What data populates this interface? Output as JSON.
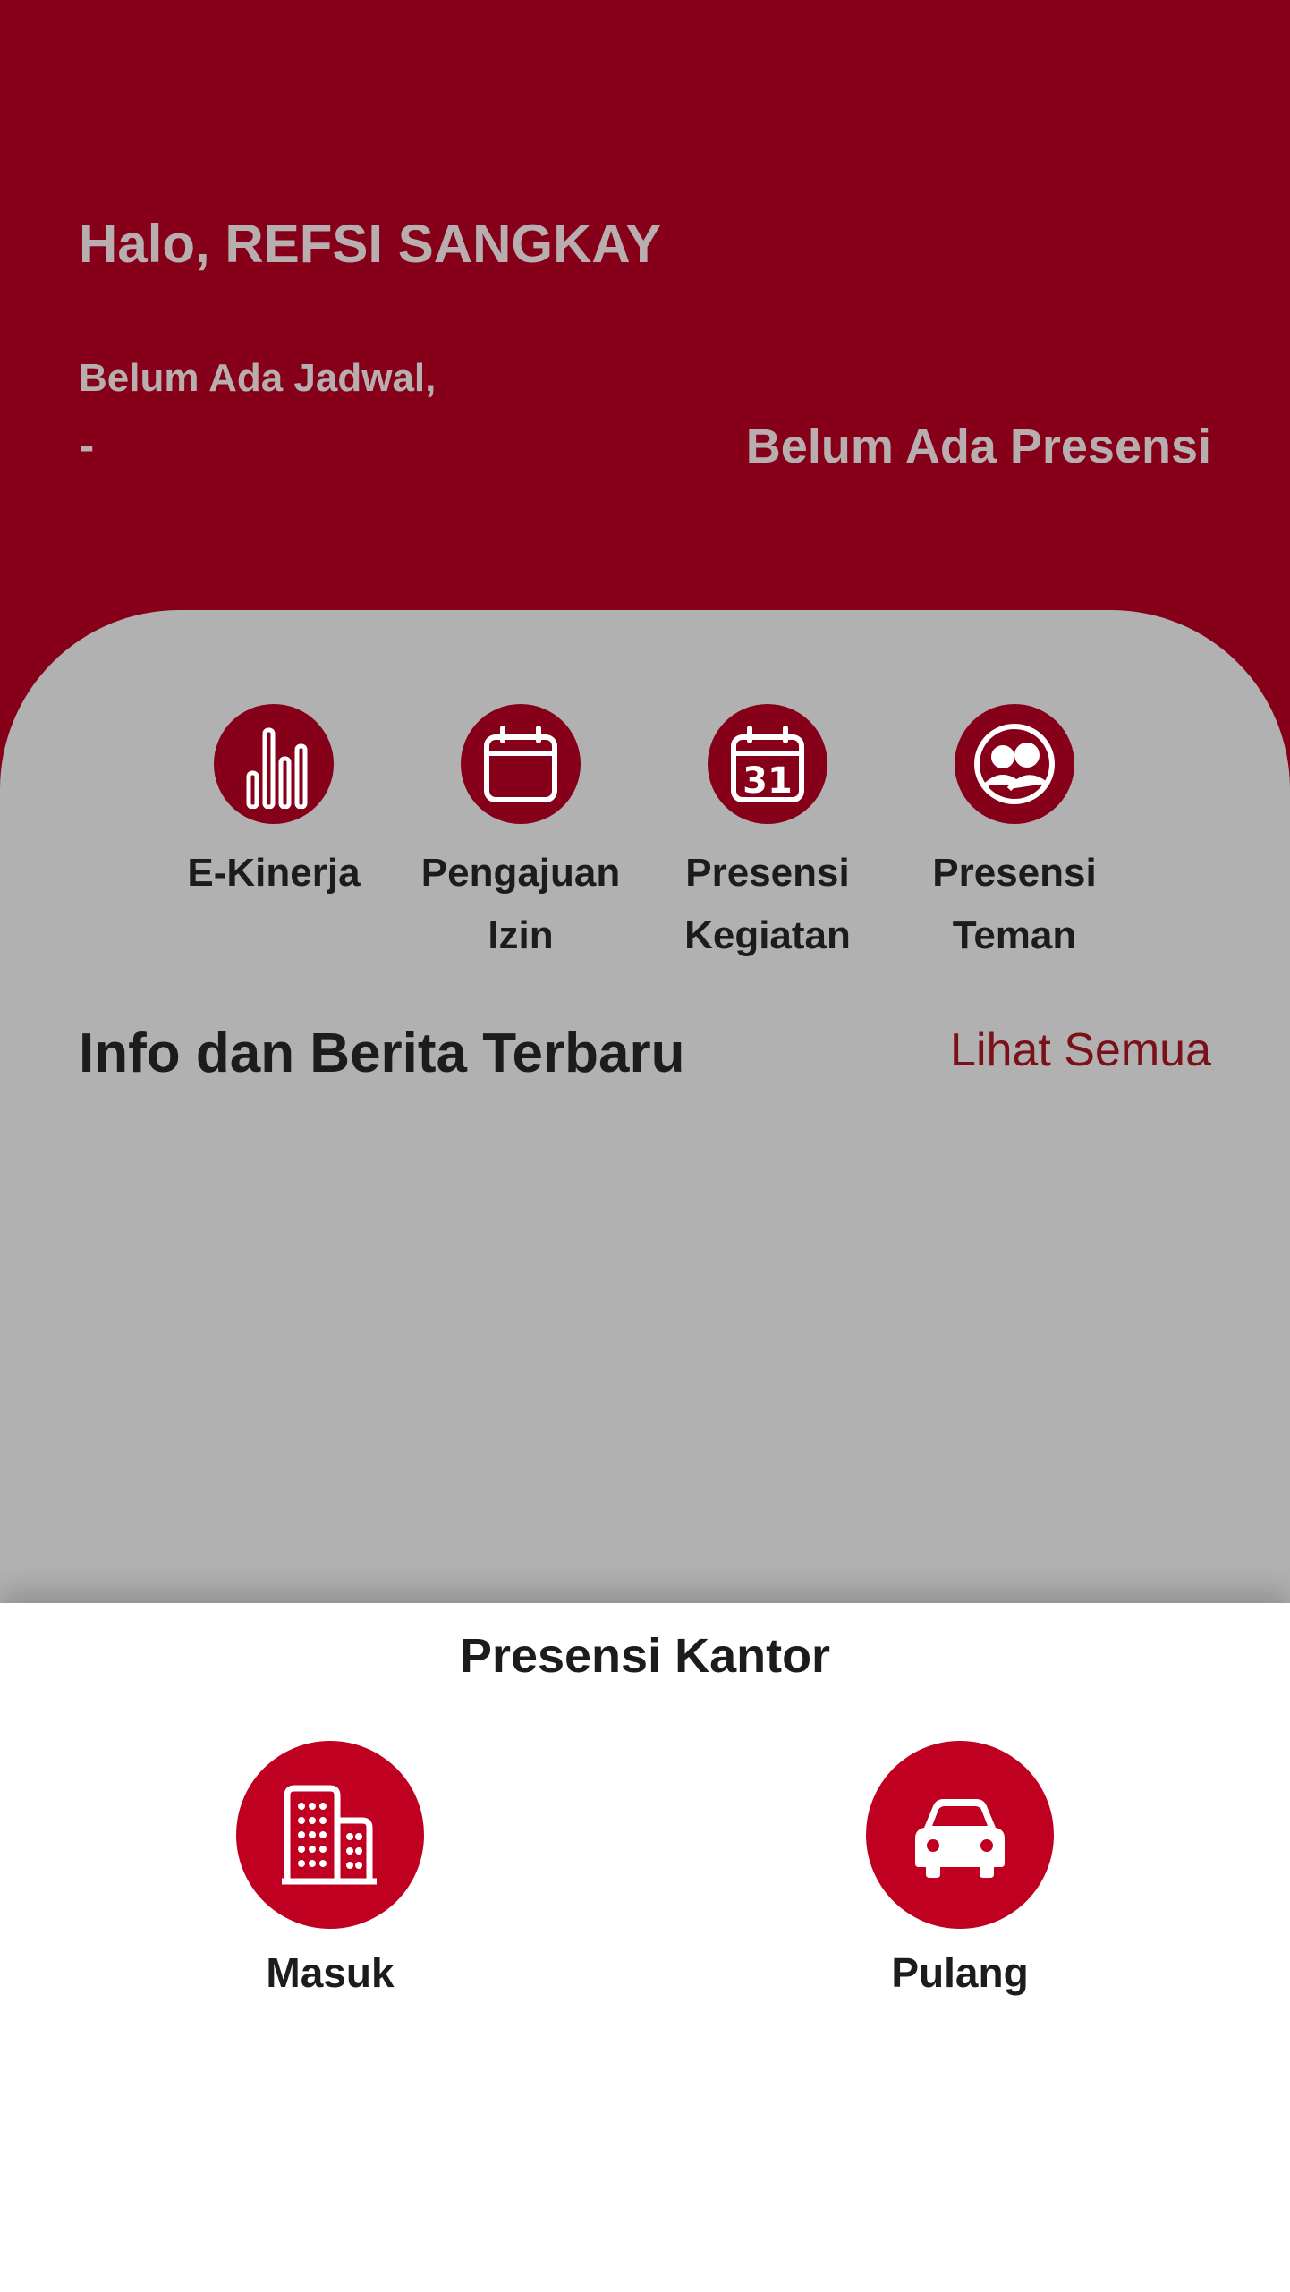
{
  "header": {
    "greeting": "Halo, REFSI SANGKAY",
    "schedule_label": "Belum Ada Jadwal,",
    "schedule_value": "-",
    "presence_status": "Belum Ada Presensi"
  },
  "menu": [
    {
      "line1": "E-Kinerja",
      "line2": "",
      "icon": "bar-chart-icon"
    },
    {
      "line1": "Pengajuan",
      "line2": "Izin",
      "icon": "calendar-icon"
    },
    {
      "line1": "Presensi",
      "line2": "Kegiatan",
      "icon": "calendar-31-icon"
    },
    {
      "line1": "Presensi",
      "line2": "Teman",
      "icon": "friends-icon"
    }
  ],
  "news": {
    "title": "Info dan Berita Terbaru",
    "see_all": "Lihat Semua"
  },
  "office_attendance": {
    "title": "Presensi Kantor",
    "check_in_label": "Masuk",
    "check_in_icon": "building-icon",
    "check_out_label": "Pulang",
    "check_out_icon": "car-icon"
  },
  "colors": {
    "header_bg": "#850018",
    "overlay_bg": "#b1b1b1",
    "icon_bg": "#850018",
    "action_bg": "#c00020",
    "link": "#7a1018"
  }
}
